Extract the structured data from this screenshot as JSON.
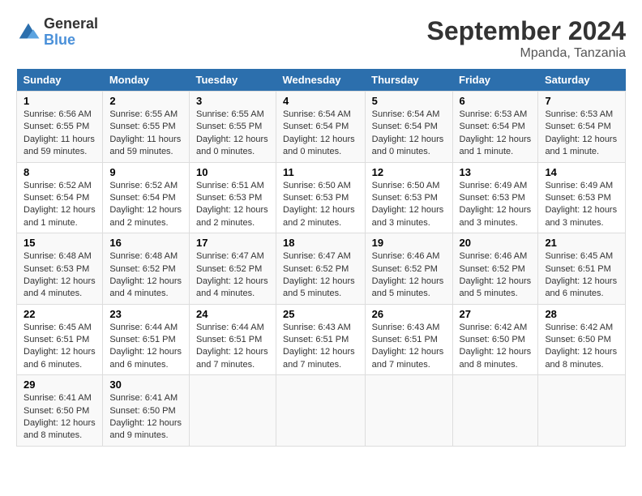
{
  "header": {
    "logo": {
      "line1": "General",
      "line2": "Blue"
    },
    "title": "September 2024",
    "location": "Mpanda, Tanzania"
  },
  "weekdays": [
    "Sunday",
    "Monday",
    "Tuesday",
    "Wednesday",
    "Thursday",
    "Friday",
    "Saturday"
  ],
  "weeks": [
    [
      {
        "day": "1",
        "info": "Sunrise: 6:56 AM\nSunset: 6:55 PM\nDaylight: 11 hours\nand 59 minutes."
      },
      {
        "day": "2",
        "info": "Sunrise: 6:55 AM\nSunset: 6:55 PM\nDaylight: 11 hours\nand 59 minutes."
      },
      {
        "day": "3",
        "info": "Sunrise: 6:55 AM\nSunset: 6:55 PM\nDaylight: 12 hours\nand 0 minutes."
      },
      {
        "day": "4",
        "info": "Sunrise: 6:54 AM\nSunset: 6:54 PM\nDaylight: 12 hours\nand 0 minutes."
      },
      {
        "day": "5",
        "info": "Sunrise: 6:54 AM\nSunset: 6:54 PM\nDaylight: 12 hours\nand 0 minutes."
      },
      {
        "day": "6",
        "info": "Sunrise: 6:53 AM\nSunset: 6:54 PM\nDaylight: 12 hours\nand 1 minute."
      },
      {
        "day": "7",
        "info": "Sunrise: 6:53 AM\nSunset: 6:54 PM\nDaylight: 12 hours\nand 1 minute."
      }
    ],
    [
      {
        "day": "8",
        "info": "Sunrise: 6:52 AM\nSunset: 6:54 PM\nDaylight: 12 hours\nand 1 minute."
      },
      {
        "day": "9",
        "info": "Sunrise: 6:52 AM\nSunset: 6:54 PM\nDaylight: 12 hours\nand 2 minutes."
      },
      {
        "day": "10",
        "info": "Sunrise: 6:51 AM\nSunset: 6:53 PM\nDaylight: 12 hours\nand 2 minutes."
      },
      {
        "day": "11",
        "info": "Sunrise: 6:50 AM\nSunset: 6:53 PM\nDaylight: 12 hours\nand 2 minutes."
      },
      {
        "day": "12",
        "info": "Sunrise: 6:50 AM\nSunset: 6:53 PM\nDaylight: 12 hours\nand 3 minutes."
      },
      {
        "day": "13",
        "info": "Sunrise: 6:49 AM\nSunset: 6:53 PM\nDaylight: 12 hours\nand 3 minutes."
      },
      {
        "day": "14",
        "info": "Sunrise: 6:49 AM\nSunset: 6:53 PM\nDaylight: 12 hours\nand 3 minutes."
      }
    ],
    [
      {
        "day": "15",
        "info": "Sunrise: 6:48 AM\nSunset: 6:53 PM\nDaylight: 12 hours\nand 4 minutes."
      },
      {
        "day": "16",
        "info": "Sunrise: 6:48 AM\nSunset: 6:52 PM\nDaylight: 12 hours\nand 4 minutes."
      },
      {
        "day": "17",
        "info": "Sunrise: 6:47 AM\nSunset: 6:52 PM\nDaylight: 12 hours\nand 4 minutes."
      },
      {
        "day": "18",
        "info": "Sunrise: 6:47 AM\nSunset: 6:52 PM\nDaylight: 12 hours\nand 5 minutes."
      },
      {
        "day": "19",
        "info": "Sunrise: 6:46 AM\nSunset: 6:52 PM\nDaylight: 12 hours\nand 5 minutes."
      },
      {
        "day": "20",
        "info": "Sunrise: 6:46 AM\nSunset: 6:52 PM\nDaylight: 12 hours\nand 5 minutes."
      },
      {
        "day": "21",
        "info": "Sunrise: 6:45 AM\nSunset: 6:51 PM\nDaylight: 12 hours\nand 6 minutes."
      }
    ],
    [
      {
        "day": "22",
        "info": "Sunrise: 6:45 AM\nSunset: 6:51 PM\nDaylight: 12 hours\nand 6 minutes."
      },
      {
        "day": "23",
        "info": "Sunrise: 6:44 AM\nSunset: 6:51 PM\nDaylight: 12 hours\nand 6 minutes."
      },
      {
        "day": "24",
        "info": "Sunrise: 6:44 AM\nSunset: 6:51 PM\nDaylight: 12 hours\nand 7 minutes."
      },
      {
        "day": "25",
        "info": "Sunrise: 6:43 AM\nSunset: 6:51 PM\nDaylight: 12 hours\nand 7 minutes."
      },
      {
        "day": "26",
        "info": "Sunrise: 6:43 AM\nSunset: 6:51 PM\nDaylight: 12 hours\nand 7 minutes."
      },
      {
        "day": "27",
        "info": "Sunrise: 6:42 AM\nSunset: 6:50 PM\nDaylight: 12 hours\nand 8 minutes."
      },
      {
        "day": "28",
        "info": "Sunrise: 6:42 AM\nSunset: 6:50 PM\nDaylight: 12 hours\nand 8 minutes."
      }
    ],
    [
      {
        "day": "29",
        "info": "Sunrise: 6:41 AM\nSunset: 6:50 PM\nDaylight: 12 hours\nand 8 minutes."
      },
      {
        "day": "30",
        "info": "Sunrise: 6:41 AM\nSunset: 6:50 PM\nDaylight: 12 hours\nand 9 minutes."
      },
      {
        "day": "",
        "info": ""
      },
      {
        "day": "",
        "info": ""
      },
      {
        "day": "",
        "info": ""
      },
      {
        "day": "",
        "info": ""
      },
      {
        "day": "",
        "info": ""
      }
    ]
  ]
}
